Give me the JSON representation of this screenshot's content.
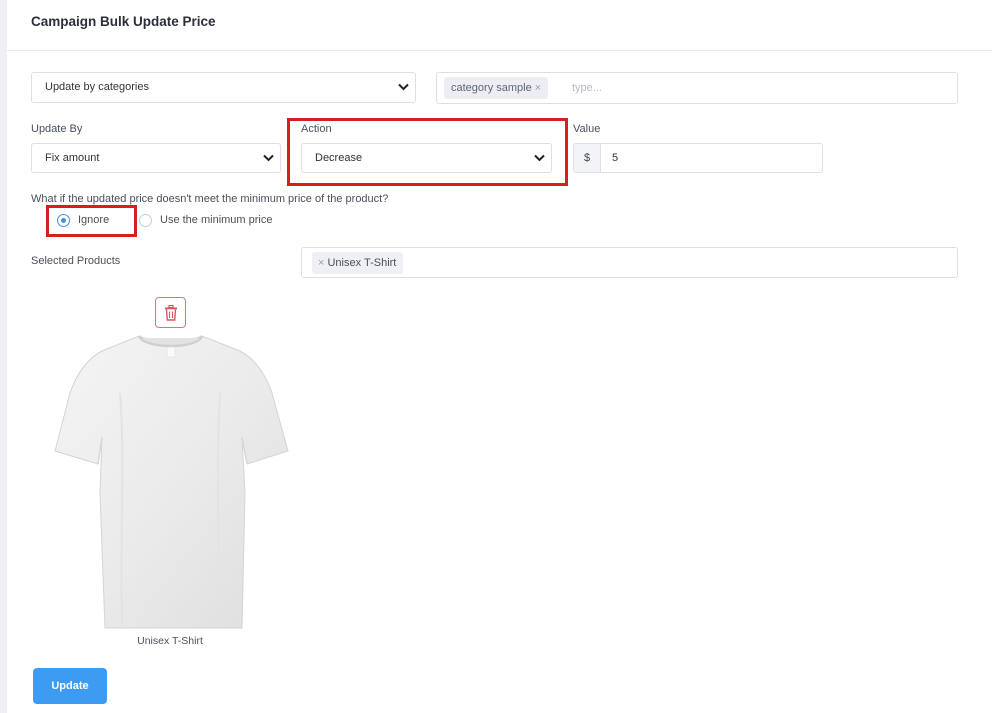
{
  "header": {
    "title": "Campaign Bulk Update Price"
  },
  "update_mode": {
    "selected": "Update by categories"
  },
  "categories": {
    "tags": [
      "category sample"
    ],
    "placeholder": "type..."
  },
  "update_by": {
    "label": "Update By",
    "selected": "Fix amount"
  },
  "action": {
    "label": "Action",
    "selected": "Decrease"
  },
  "value": {
    "label": "Value",
    "currency": "$",
    "amount": "5"
  },
  "min_price": {
    "question": "What if the updated price doesn't meet the minimum price of the product?",
    "options": [
      "Ignore",
      "Use the minimum price"
    ],
    "selected": "Ignore"
  },
  "selected_products": {
    "label": "Selected Products",
    "tags": [
      "Unisex T-Shirt"
    ]
  },
  "products": [
    {
      "name": "Unisex T-Shirt",
      "icon": "t-shirt-image"
    }
  ],
  "buttons": {
    "update": "Update",
    "remove_icon": "trash-icon"
  },
  "colors": {
    "primary": "#3d9bf2",
    "highlight": "#d42020",
    "danger": "#e0717a"
  }
}
